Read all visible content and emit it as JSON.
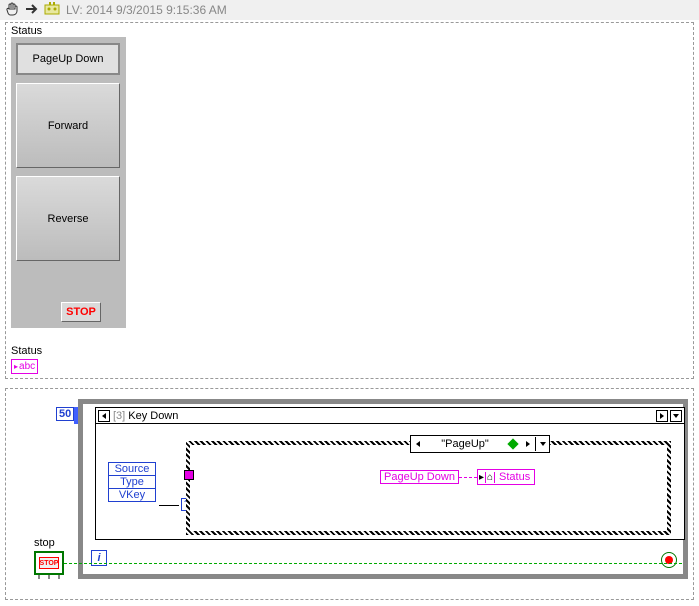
{
  "toolbar": {
    "title": "LV: 2014 9/3/2015 9:15:36 AM"
  },
  "front_panel": {
    "labels": {
      "status_top": "Status",
      "status_bot": "Status",
      "abc": "abc"
    },
    "buttons": [
      "PageUp Down",
      "Forward",
      "Reverse"
    ],
    "stop": "STOP"
  },
  "diagram": {
    "wait_ms": "50",
    "event_case": {
      "index": "[3]",
      "name": "Key Down"
    },
    "sources": [
      "Source",
      "Type",
      "VKey"
    ],
    "inner_case": "\"PageUp\"",
    "string_const": "PageUp Down",
    "local_var": "Status",
    "stop_label": "stop",
    "stop_text": "STOP",
    "iter": "i",
    "q_mark": "?"
  }
}
